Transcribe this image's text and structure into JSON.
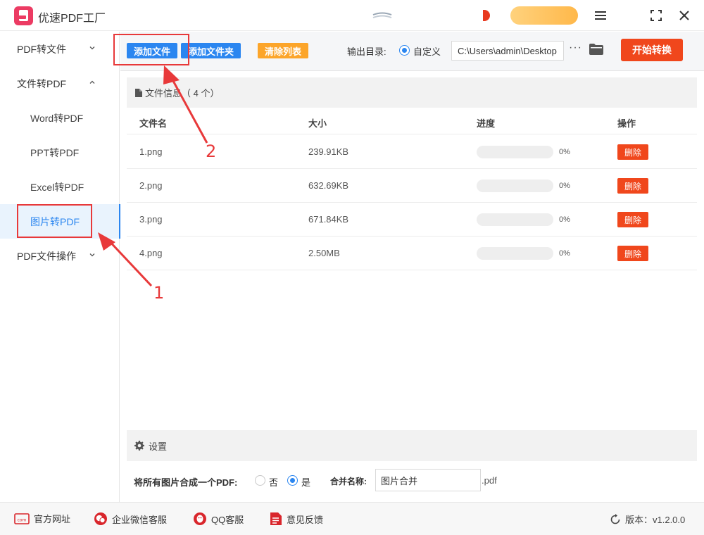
{
  "app": {
    "title": "优速PDF工厂"
  },
  "colors": {
    "accent": "#2b86f0",
    "danger": "#f0471c",
    "warning": "#fca52a",
    "annotation": "#e8393a",
    "brand": "#ec3b63"
  },
  "sidebar": {
    "items": [
      {
        "label": "PDF转文件"
      },
      {
        "label": "文件转PDF"
      },
      {
        "label": "Word转PDF"
      },
      {
        "label": "PPT转PDF"
      },
      {
        "label": "Excel转PDF"
      },
      {
        "label": "图片转PDF"
      },
      {
        "label": "PDF文件操作"
      }
    ]
  },
  "toolbar": {
    "add_file": "添加文件",
    "add_folder": "添加文件夹",
    "clear_list": "清除列表",
    "output_label": "输出目录:",
    "custom_label": "自定义",
    "output_path": "C:\\Users\\admin\\Desktop",
    "more": "···",
    "start": "开始转换"
  },
  "files": {
    "header": "文件信息（ 4 个）",
    "columns": {
      "name": "文件名",
      "size": "大小",
      "progress": "进度",
      "action": "操作"
    },
    "rows": [
      {
        "name": "1.png",
        "size": "239.91KB",
        "progress": 0,
        "progress_text": "0%",
        "action": "删除"
      },
      {
        "name": "2.png",
        "size": "632.69KB",
        "progress": 0,
        "progress_text": "0%",
        "action": "删除"
      },
      {
        "name": "3.png",
        "size": "671.84KB",
        "progress": 0,
        "progress_text": "0%",
        "action": "删除"
      },
      {
        "name": "4.png",
        "size": "2.50MB",
        "progress": 0,
        "progress_text": "0%",
        "action": "删除"
      }
    ]
  },
  "settings": {
    "title": "设置",
    "merge_label": "将所有图片合成一个PDF:",
    "option_no": "否",
    "option_yes": "是",
    "merge_selected": "是",
    "name_label": "合并名称:",
    "name_value": "图片合并",
    "ext": ".pdf"
  },
  "footer": {
    "website": "官方网址",
    "wechat": "企业微信客服",
    "qq": "QQ客服",
    "feedback": "意见反馈",
    "version_label": "版本：v1.2.0.0"
  },
  "annotations": {
    "step1": "1",
    "step2": "2"
  }
}
